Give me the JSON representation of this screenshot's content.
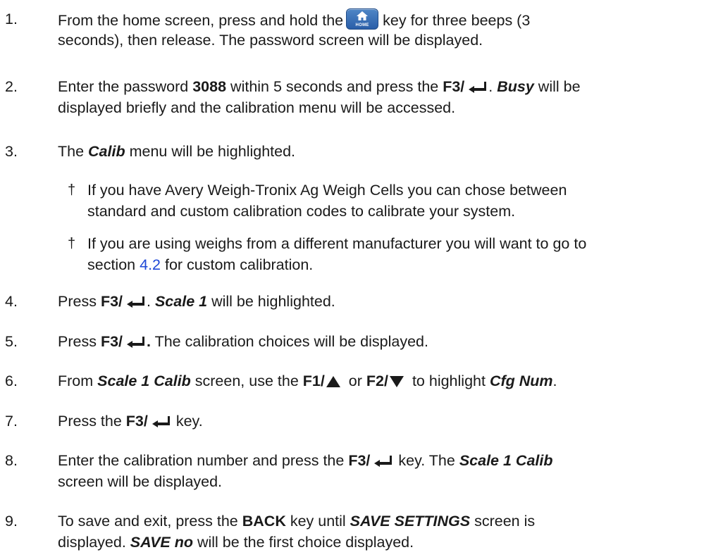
{
  "steps": [
    {
      "num": "1.",
      "a": "From the home screen, press and hold the",
      "key_label": "HOME",
      "b": "key for three beeps (3",
      "c": "seconds), then release. The password screen will be displayed."
    },
    {
      "num": "2.",
      "a": "Enter the password ",
      "pw": "3088",
      "b": " within 5 seconds and press the ",
      "key": "F3/",
      "c": ". ",
      "busy": "Busy",
      "d": " will be",
      "e": "displayed briefly and the calibration menu will be accessed."
    },
    {
      "num": "3.",
      "a": "The ",
      "calib": "Calib",
      "b": " menu will be highlighted."
    },
    {
      "num": "4.",
      "a": "Press ",
      "key": "F3/",
      "b": ". ",
      "scale": "Scale 1",
      "c": " will be highlighted."
    },
    {
      "num": "5.",
      "a": "Press ",
      "key": "F3/",
      "b": ".",
      "c": " The calibration choices will be displayed."
    },
    {
      "num": "6.",
      "a": "From ",
      "screen": "Scale 1 Calib",
      "b": " screen, use the ",
      "f1": "F1/",
      "or": " or ",
      "f2": "F2/",
      "c": " to highlight ",
      "cfg": "Cfg Num",
      "d": "."
    },
    {
      "num": "7.",
      "a": "Press the ",
      "key": "F3/",
      "b": " key."
    },
    {
      "num": "8.",
      "a": "Enter the calibration number and press the ",
      "key": "F3/",
      "b": " key. The ",
      "screen": "Scale 1 Calib",
      "c": "screen will be displayed."
    },
    {
      "num": "9.",
      "a": "To save and exit, press the ",
      "back": "BACK",
      "b": " key until ",
      "save_settings": "SAVE SETTINGS",
      "c": " screen is",
      "d": "displayed. ",
      "save_no": "SAVE no",
      "e": " will be the first choice displayed."
    }
  ],
  "bullets": [
    {
      "symbol": "†",
      "line1": "If you have Avery Weigh-Tronix Ag Weigh Cells you can chose between",
      "line2": "standard and custom calibration codes to calibrate your system."
    },
    {
      "symbol": "†",
      "line1": "If you are using weighs from a different manufacturer you will want to go to",
      "line2a": "section ",
      "link": "4.2",
      "line2b": " for custom calibration."
    }
  ],
  "icons": {
    "home_key": "home-key-icon",
    "enter": "enter-arrow-icon",
    "up": "up-triangle-icon",
    "down": "down-triangle-icon"
  },
  "colors": {
    "text": "#1a1a1a",
    "link": "#1f49d6",
    "home_key": "#3a72b8"
  }
}
